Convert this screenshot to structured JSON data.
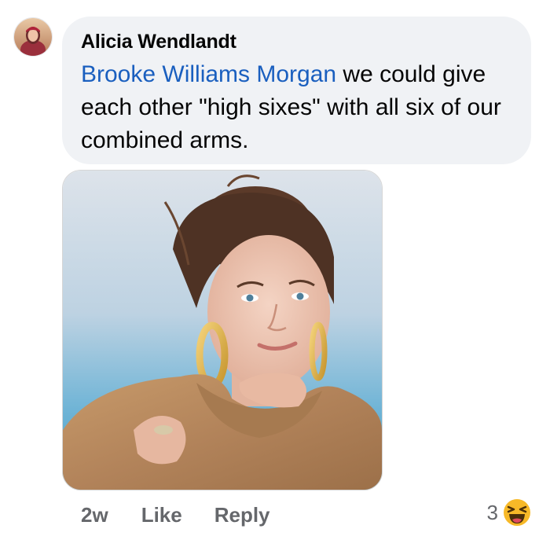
{
  "comment": {
    "author": "Alicia Wendlandt",
    "mention": "Brooke Williams Morgan",
    "text": " we could give each other \"high sixes\" with all six of our combined arms."
  },
  "actions": {
    "age": "2w",
    "like_label": "Like",
    "reply_label": "Reply"
  },
  "reactions": {
    "count": "3",
    "icon": "haha-reaction-icon"
  },
  "colors": {
    "bubble": "#f0f2f5",
    "mention": "#1a5fbf",
    "meta_text": "#65676b",
    "reaction": "#f7b928"
  }
}
